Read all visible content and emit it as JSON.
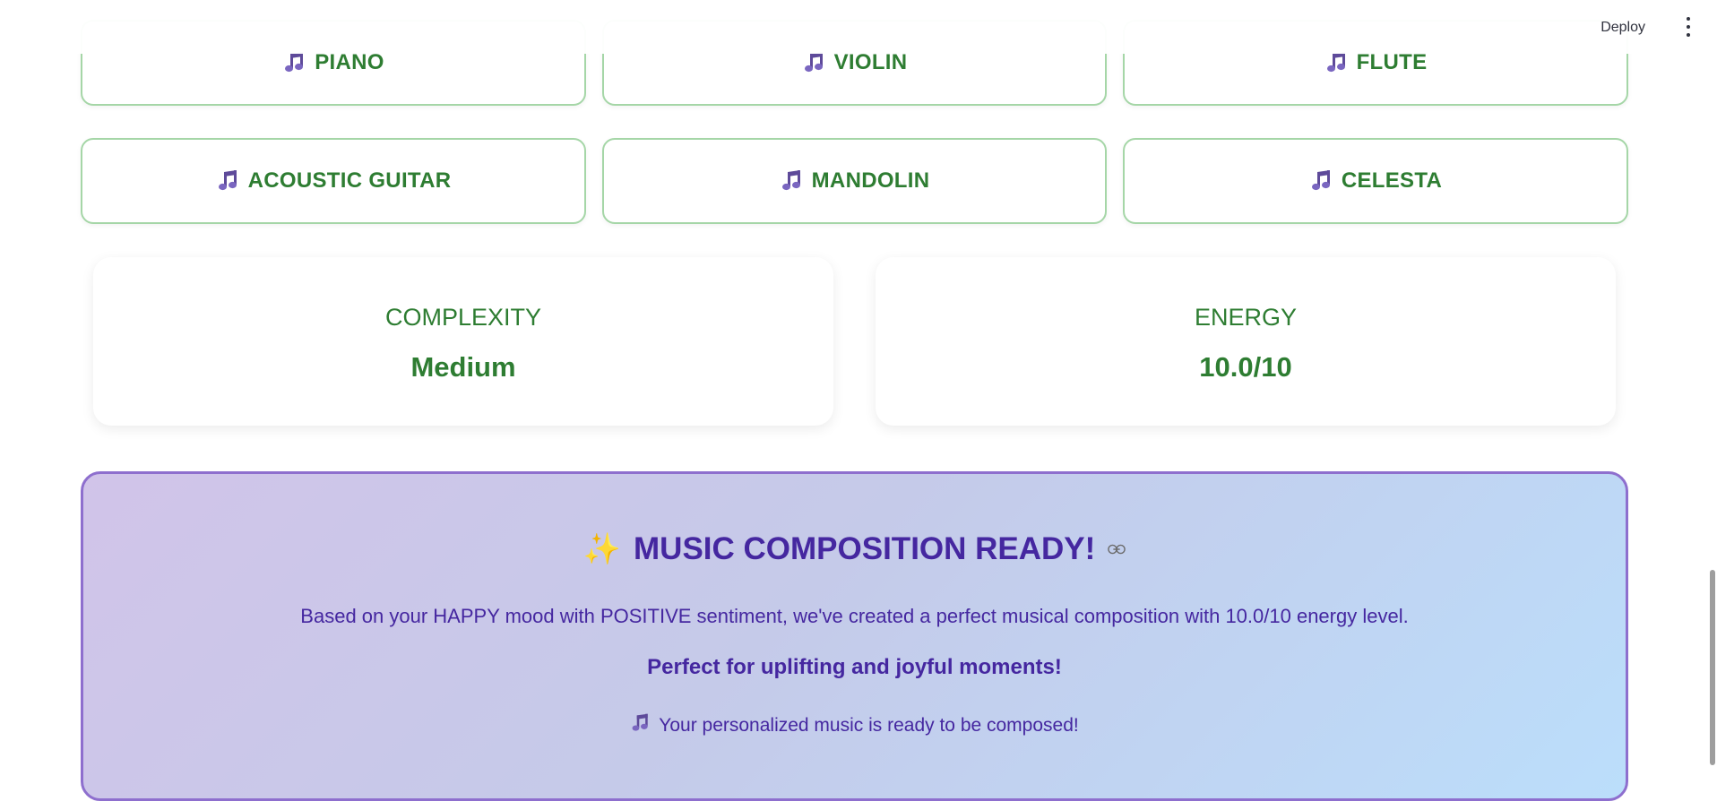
{
  "header": {
    "deploy_label": "Deploy",
    "menu_icon": "more-vertical-icon"
  },
  "instruments": {
    "icon": "music-note-icon",
    "row1": [
      "PIANO",
      "VIOLIN",
      "FLUTE"
    ],
    "row2": [
      "ACOUSTIC GUITAR",
      "MANDOLIN",
      "CELESTA"
    ]
  },
  "stats": {
    "complexity": {
      "label": "COMPLEXITY",
      "value": "Medium"
    },
    "energy": {
      "label": "ENERGY",
      "value": "10.0/10"
    }
  },
  "ready": {
    "sparkle": "✨",
    "title": "MUSIC COMPOSITION READY!",
    "link_icon": "⛓",
    "description": "Based on your HAPPY mood with POSITIVE sentiment, we've created a perfect musical composition with 10.0/10 energy level.",
    "tagline": "Perfect for uplifting and joyful moments!",
    "footer": "Your personalized music is ready to be composed!"
  },
  "colors": {
    "accent_green": "#2e7d32",
    "card_border": "#a5d6a7",
    "ready_border": "#8e6fce",
    "ready_text": "#4527a0"
  }
}
